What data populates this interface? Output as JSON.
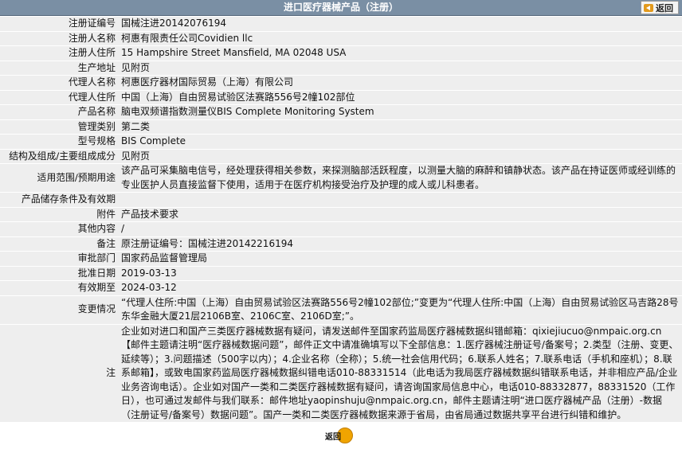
{
  "header": {
    "title": "进口医疗器械产品（注册）",
    "back_label": "返回"
  },
  "rows": [
    {
      "label": "注册证编号",
      "value": "国械注进20142076194"
    },
    {
      "label": "注册人名称",
      "value": "柯惠有限责任公司Covidien llc"
    },
    {
      "label": "注册人住所",
      "value": "15 Hampshire Street Mansfield, MA 02048 USA"
    },
    {
      "label": "生产地址",
      "value": "见附页"
    },
    {
      "label": "代理人名称",
      "value": "柯惠医疗器材国际贸易（上海）有限公司"
    },
    {
      "label": "代理人住所",
      "value": "中国（上海）自由贸易试验区法赛路556号2幢102部位"
    },
    {
      "label": "产品名称",
      "value": "脑电双频谱指数测量仪BIS Complete Monitoring System"
    },
    {
      "label": "管理类别",
      "value": "第二类"
    },
    {
      "label": "型号规格",
      "value": "BIS Complete"
    },
    {
      "label": "结构及组成/主要组成成分",
      "value": "见附页"
    },
    {
      "label": "适用范围/预期用途",
      "value": "该产品可采集脑电信号，经处理获得相关参数，来探测脑部活跃程度，以测量大脑的麻醉和镇静状态。该产品在持证医师或经训练的专业医护人员直接监督下使用，适用于在医疗机构接受治疗及护理的成人或儿科患者。"
    },
    {
      "label": "产品储存条件及有效期",
      "value": ""
    },
    {
      "label": "附件",
      "value": "产品技术要求"
    },
    {
      "label": "其他内容",
      "value": "/"
    },
    {
      "label": "备注",
      "value": "原注册证编号：国械注进20142216194"
    },
    {
      "label": "审批部门",
      "value": "国家药品监督管理局"
    },
    {
      "label": "批准日期",
      "value": "2019-03-13"
    },
    {
      "label": "有效期至",
      "value": "2024-03-12"
    },
    {
      "label": "变更情况",
      "value": "“代理人住所:中国（上海）自由贸易试验区法赛路556号2幢102部位;”变更为“代理人住所:中国（上海）自由贸易试验区马吉路28号东华金融大厦21层2106B室、2106C室、2106D室;”。"
    },
    {
      "label": "注",
      "value": "企业如对进口和国产三类医疗器械数据有疑问，请发送邮件至国家药监局医疗器械数据纠错邮箱：qixiejiucuo@nmpaic.org.cn【邮件主题请注明“医疗器械数据问题”，邮件正文中请准确填写以下全部信息：1.医疗器械注册证号/备案号；2.类型（注册、变更、延续等）；3.问题描述（500字以内）；4.企业名称（全称）；5.统一社会信用代码；6.联系人姓名；7.联系电话（手机和座机）；8.联系邮箱】，或致电国家药监局医疗器械数据纠错电话010-88331514（此电话为我局医疗器械数据纠错联系电话，并非相应产品/企业业务咨询电话）。企业如对国产一类和二类医疗器械数据有疑问，请咨询国家局信息中心，电话010-88332877，88331520（工作日），也可通过发邮件与我们联系：邮件地址yaopinshuju@nmpaic.org.cn，邮件主题请注明“进口医疗器械产品（注册）-数据（注册证号/备案号）数据问题”。国产一类和二类医疗器械数据来源于省局，由省局通过数据共享平台进行纠错和维护。"
    }
  ],
  "footer": {
    "back_label": "返回"
  }
}
